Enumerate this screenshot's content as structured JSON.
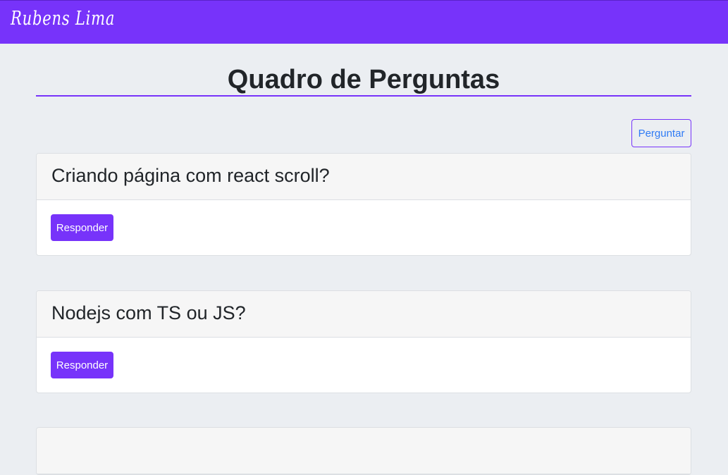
{
  "navbar": {
    "brand": "Rubens Lima"
  },
  "page": {
    "title": "Quadro de Perguntas",
    "ask_button_label": "Perguntar"
  },
  "questions": [
    {
      "title": "Criando página com react scroll?",
      "reply_label": "Responder"
    },
    {
      "title": "Nodejs com TS ou JS?",
      "reply_label": "Responder"
    },
    {
      "title": "",
      "reply_label": ""
    }
  ],
  "colors": {
    "accent": "#7733fa",
    "background": "#ebeef2",
    "link": "#2f7bf5"
  }
}
